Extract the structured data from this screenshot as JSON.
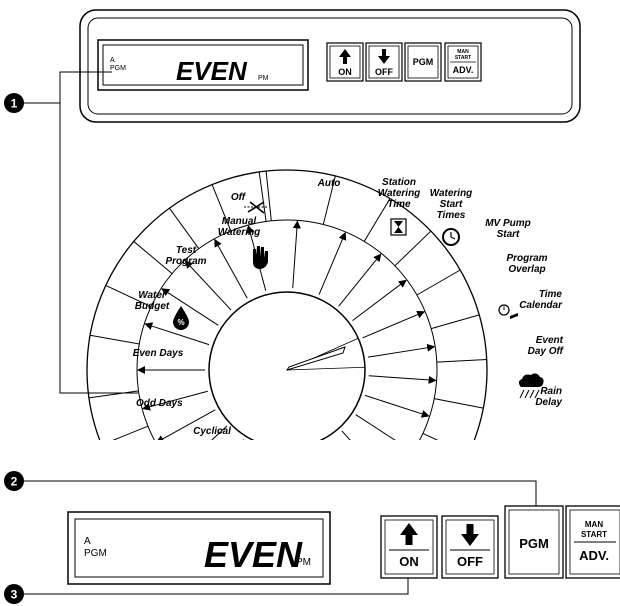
{
  "top_panel": {
    "display": {
      "indicator_a": "A",
      "indicator_pgm": "PGM",
      "main": "EVEN",
      "suffix": "PM"
    },
    "buttons": {
      "on": "ON",
      "off": "OFF",
      "pgm": "PGM",
      "man": "MAN",
      "start": "START",
      "adv": "ADV."
    }
  },
  "callouts": {
    "one": "1",
    "two": "2",
    "three": "3"
  },
  "dial": {
    "positions": [
      {
        "id": "auto",
        "lines": [
          "Auto"
        ]
      },
      {
        "id": "off",
        "lines": [
          "Off"
        ]
      },
      {
        "id": "manual-watering",
        "lines": [
          "Manual",
          "Watering"
        ]
      },
      {
        "id": "test-program",
        "lines": [
          "Test",
          "Program"
        ]
      },
      {
        "id": "water-budget",
        "lines": [
          "Water",
          "Budget"
        ]
      },
      {
        "id": "even-days",
        "lines": [
          "Even  Days"
        ]
      },
      {
        "id": "odd-days",
        "lines": [
          "Odd  Days"
        ]
      },
      {
        "id": "cyclical",
        "lines": [
          "Cyclical"
        ]
      },
      {
        "id": "station-watering-time",
        "lines": [
          "Station",
          "Watering",
          "Time"
        ]
      },
      {
        "id": "watering-start-times",
        "lines": [
          "Watering",
          "Start",
          "Times"
        ]
      },
      {
        "id": "mv-pump-start",
        "lines": [
          "MV Pump",
          "Start"
        ]
      },
      {
        "id": "program-overlap",
        "lines": [
          "Program",
          "Overlap"
        ]
      },
      {
        "id": "time-calendar",
        "lines": [
          "Time",
          "Calendar"
        ]
      },
      {
        "id": "event-day-off",
        "lines": [
          "Event",
          "Day Off"
        ]
      },
      {
        "id": "rain-delay",
        "lines": [
          "Rain",
          "Delay"
        ]
      }
    ]
  },
  "bottom_panel": {
    "display": {
      "indicator_a": "A",
      "indicator_pgm": "PGM",
      "main": "EVEN",
      "suffix": "PM"
    },
    "buttons": {
      "on": "ON",
      "off": "OFF",
      "pgm": "PGM",
      "man": "MAN",
      "start": "START",
      "adv": "ADV."
    }
  }
}
